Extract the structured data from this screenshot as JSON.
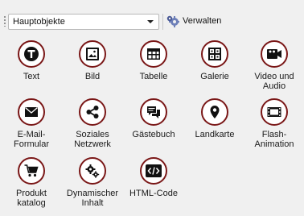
{
  "toolbar": {
    "combo_value": "Hauptobjekte",
    "manage_label": "Verwalten",
    "manage_icon": "puzzle-gear-icon"
  },
  "accent_color": "#7a1717",
  "items": [
    {
      "label": "Text",
      "icon": "text-icon"
    },
    {
      "label": "Bild",
      "icon": "image-icon"
    },
    {
      "label": "Tabelle",
      "icon": "table-icon"
    },
    {
      "label": "Galerie",
      "icon": "gallery-icon"
    },
    {
      "label": "Video und\nAudio",
      "icon": "video-audio-icon"
    },
    {
      "label": "E-Mail-\nFormular",
      "icon": "email-icon"
    },
    {
      "label": "Soziales\nNetzwerk",
      "icon": "share-icon"
    },
    {
      "label": "Gästebuch",
      "icon": "chat-icon"
    },
    {
      "label": "Landkarte",
      "icon": "map-pin-icon"
    },
    {
      "label": "Flash-\nAnimation",
      "icon": "film-icon"
    },
    {
      "label": "Produkt\nkatalog",
      "icon": "cart-icon"
    },
    {
      "label": "Dynamischer\nInhalt",
      "icon": "gears-icon"
    },
    {
      "label": "HTML-Code",
      "icon": "code-icon"
    }
  ]
}
